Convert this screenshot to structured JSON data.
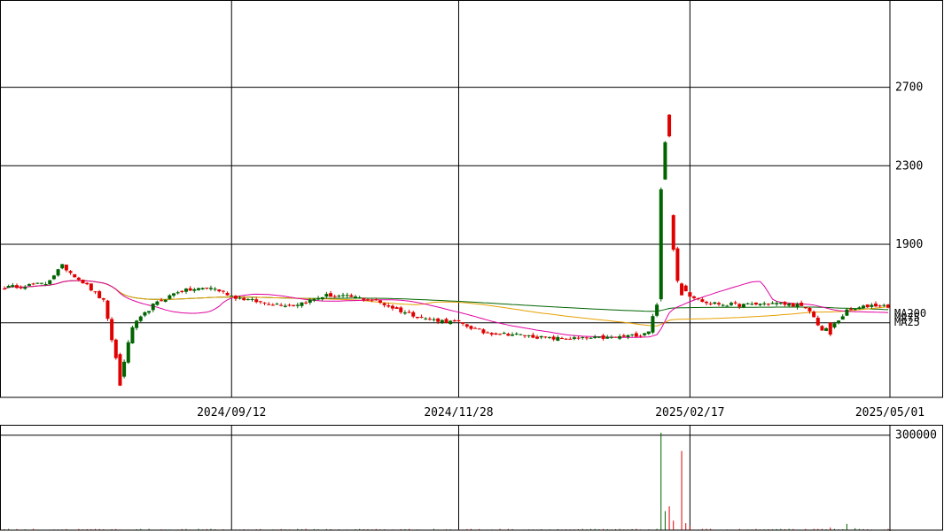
{
  "chart_data": {
    "type": "candlestick",
    "price_axis": {
      "ticks": [
        1900,
        2300,
        2700
      ],
      "range": [
        1120,
        3140
      ]
    },
    "date_axis": {
      "labels": [
        "2024/09/12",
        "2024/11/28",
        "2025/02/17",
        "2025/05/01"
      ]
    },
    "volume_axis": {
      "ticks": [
        300000
      ],
      "range": [
        0,
        330000
      ]
    },
    "moving_averages": [
      {
        "name": "MA200",
        "color": "#006400"
      },
      {
        "name": "MA75",
        "color": "#e6a000"
      },
      {
        "name": "MA25",
        "color": "#e000a0"
      }
    ],
    "colors": {
      "up": "#006400",
      "down": "#e00000",
      "grid": "#000000"
    },
    "anchors": [
      [
        0,
        1680
      ],
      [
        10,
        1700
      ],
      [
        14,
        1790
      ],
      [
        20,
        1690
      ],
      [
        24,
        1610
      ],
      [
        28,
        1220
      ],
      [
        31,
        1480
      ],
      [
        36,
        1590
      ],
      [
        42,
        1660
      ],
      [
        50,
        1680
      ],
      [
        56,
        1630
      ],
      [
        63,
        1600
      ],
      [
        70,
        1590
      ],
      [
        78,
        1640
      ],
      [
        85,
        1630
      ],
      [
        90,
        1610
      ],
      [
        96,
        1560
      ],
      [
        102,
        1520
      ],
      [
        110,
        1500
      ],
      [
        116,
        1450
      ],
      [
        124,
        1440
      ],
      [
        132,
        1420
      ],
      [
        140,
        1420
      ],
      [
        148,
        1425
      ],
      [
        154,
        1440
      ],
      [
        156,
        1460
      ],
      [
        158,
        1600
      ],
      [
        159,
        1950
      ],
      [
        160,
        2200
      ],
      [
        161,
        2050
      ],
      [
        162,
        1880
      ],
      [
        163,
        1720
      ],
      [
        166,
        1640
      ],
      [
        170,
        1600
      ],
      [
        178,
        1590
      ],
      [
        186,
        1600
      ],
      [
        192,
        1590
      ],
      [
        195,
        1560
      ],
      [
        198,
        1460
      ],
      [
        200,
        1470
      ],
      [
        204,
        1560
      ],
      [
        210,
        1590
      ],
      [
        214,
        1585
      ]
    ],
    "volume_spikes": [
      [
        159,
        308000
      ],
      [
        160,
        60000
      ],
      [
        161,
        75000
      ],
      [
        162,
        30000
      ],
      [
        164,
        250000
      ],
      [
        165,
        22000
      ],
      [
        166,
        12000
      ],
      [
        200,
        8000
      ],
      [
        204,
        20000
      ],
      [
        206,
        6000
      ]
    ]
  }
}
